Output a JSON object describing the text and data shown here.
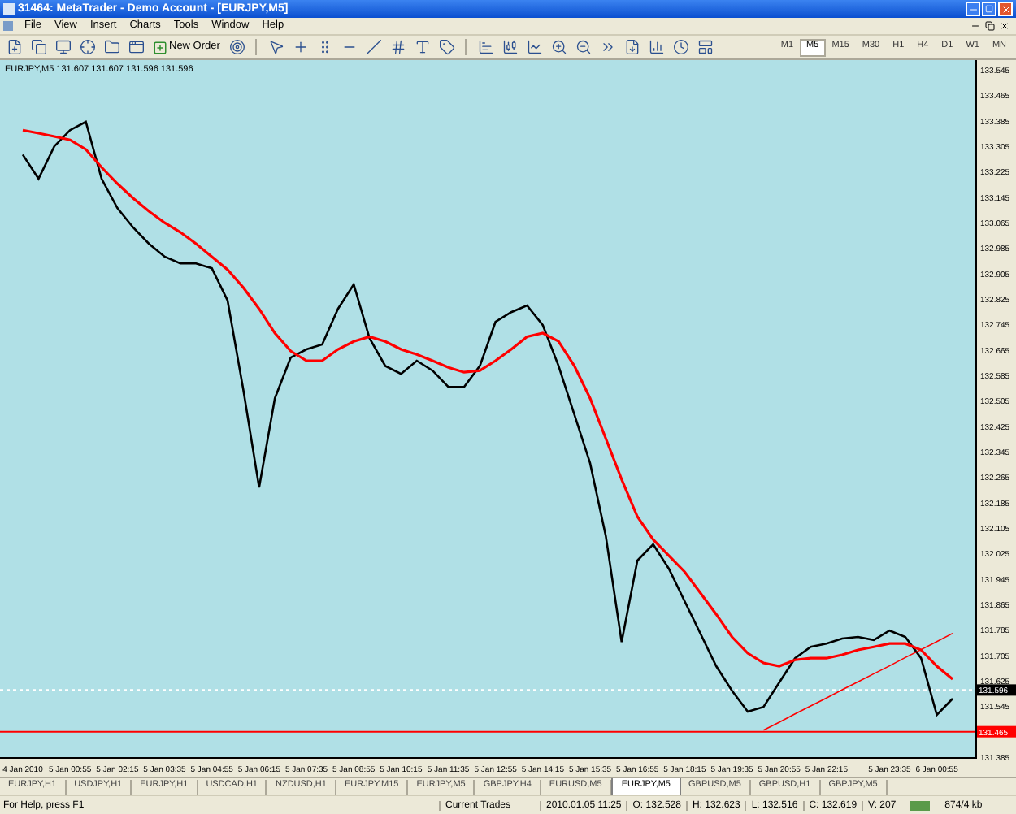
{
  "window": {
    "title": "31464: MetaTrader - Demo Account - [EURJPY,M5]"
  },
  "menu": [
    "File",
    "View",
    "Insert",
    "Charts",
    "Tools",
    "Window",
    "Help"
  ],
  "toolbar": {
    "new_order": "New Order"
  },
  "timeframes": [
    {
      "label": "M1",
      "selected": false
    },
    {
      "label": "M5",
      "selected": true
    },
    {
      "label": "M15",
      "selected": false
    },
    {
      "label": "M30",
      "selected": false
    },
    {
      "label": "H1",
      "selected": false
    },
    {
      "label": "H4",
      "selected": false
    },
    {
      "label": "D1",
      "selected": false
    },
    {
      "label": "W1",
      "selected": false
    },
    {
      "label": "MN",
      "selected": false
    }
  ],
  "chart": {
    "chart_data": {
      "type": "line",
      "title": "EURJPY,M5  131.607 131.607 131.596 131.596",
      "categories": [
        "4 Jan 2010",
        null,
        null,
        "5 Jan 00:55",
        null,
        null,
        "5 Jan 02:15",
        null,
        null,
        "5 Jan 03:35",
        null,
        null,
        "5 Jan 04:55",
        null,
        null,
        "5 Jan 06:15",
        null,
        null,
        "5 Jan 07:35",
        null,
        null,
        "5 Jan 08:55",
        null,
        null,
        "5 Jan 10:15",
        null,
        null,
        "5 Jan 11:35",
        null,
        null,
        "5 Jan 12:55",
        null,
        null,
        "5 Jan 14:15",
        null,
        null,
        "5 Jan 15:35",
        null,
        null,
        "5 Jan 16:55",
        null,
        null,
        "5 Jan 18:15",
        null,
        null,
        "5 Jan 19:35",
        null,
        null,
        "5 Jan 20:55",
        null,
        null,
        "5 Jan 22:15",
        null,
        null,
        null,
        "5 Jan 23:35",
        null,
        null,
        "6 Jan 00:55",
        null
      ],
      "ylim": [
        131.385,
        133.576
      ],
      "series": [
        {
          "color": "#000000",
          "values": [
            133.279,
            133.203,
            133.305,
            133.356,
            133.382,
            133.203,
            133.111,
            133.05,
            132.999,
            132.958,
            132.937,
            132.937,
            132.922,
            132.82,
            132.539,
            132.233,
            132.513,
            132.641,
            132.667,
            132.682,
            132.794,
            132.871,
            132.702,
            132.615,
            132.59,
            132.631,
            132.6,
            132.549,
            132.549,
            132.615,
            132.753,
            132.784,
            132.805,
            132.743,
            132.615,
            132.462,
            132.309,
            132.079,
            131.747,
            132.003,
            132.054,
            131.977,
            131.875,
            131.773,
            131.671,
            131.594,
            131.528,
            131.543,
            131.62,
            131.696,
            131.732,
            131.742,
            131.758,
            131.763,
            131.753,
            131.783,
            131.763,
            131.696,
            131.518,
            131.569
          ]
        },
        {
          "color": "#ff0000",
          "values": [
            133.356,
            133.346,
            133.336,
            133.325,
            133.295,
            133.239,
            133.188,
            133.142,
            133.101,
            133.065,
            133.035,
            132.999,
            132.958,
            132.917,
            132.861,
            132.794,
            132.718,
            132.662,
            132.631,
            132.631,
            132.667,
            132.692,
            132.707,
            132.692,
            132.667,
            132.651,
            132.631,
            132.61,
            132.595,
            132.6,
            132.631,
            132.667,
            132.707,
            132.718,
            132.692,
            132.615,
            132.513,
            132.386,
            132.258,
            132.141,
            132.069,
            132.018,
            131.967,
            131.901,
            131.834,
            131.763,
            131.712,
            131.681,
            131.671,
            131.691,
            131.696,
            131.696,
            131.707,
            131.722,
            131.732,
            131.742,
            131.742,
            131.722,
            131.671,
            131.63
          ]
        },
        {
          "color": "#ff0000",
          "values": [
            null,
            null,
            null,
            null,
            null,
            null,
            null,
            null,
            null,
            null,
            null,
            null,
            null,
            null,
            null,
            null,
            null,
            null,
            null,
            null,
            null,
            null,
            null,
            null,
            null,
            null,
            null,
            null,
            null,
            null,
            null,
            null,
            null,
            null,
            null,
            null,
            null,
            null,
            null,
            null,
            null,
            null,
            null,
            null,
            null,
            null,
            null,
            131.47,
            131.495,
            131.521,
            131.546,
            131.571,
            131.597,
            131.622,
            131.647,
            131.672,
            131.698,
            131.723,
            131.748,
            131.774
          ]
        }
      ],
      "yticks": [
        133.545,
        133.465,
        133.385,
        133.305,
        133.225,
        133.145,
        133.065,
        132.985,
        132.905,
        132.825,
        132.745,
        132.665,
        132.585,
        132.505,
        132.425,
        132.345,
        132.265,
        132.185,
        132.105,
        132.025,
        131.945,
        131.865,
        131.785,
        131.705,
        131.625,
        131.545,
        131.385
      ],
      "ref_lines": [
        {
          "axis": "y",
          "value": 131.596,
          "label": "131.596",
          "color": "#ffffff"
        },
        {
          "axis": "y",
          "value": 131.465,
          "label": "131.465",
          "color": "#ff0000"
        }
      ]
    }
  },
  "tabs": [
    {
      "label": "EURJPY,H1",
      "selected": false
    },
    {
      "label": "USDJPY,H1",
      "selected": false
    },
    {
      "label": "EURJPY,H1",
      "selected": false
    },
    {
      "label": "USDCAD,H1",
      "selected": false
    },
    {
      "label": "NZDUSD,H1",
      "selected": false
    },
    {
      "label": "EURJPY,M15",
      "selected": false
    },
    {
      "label": "EURJPY,M5",
      "selected": false
    },
    {
      "label": "GBPJPY,H4",
      "selected": false
    },
    {
      "label": "EURUSD,M5",
      "selected": false
    },
    {
      "label": "EURJPY,M5",
      "selected": true
    },
    {
      "label": "GBPUSD,M5",
      "selected": false
    },
    {
      "label": "GBPUSD,H1",
      "selected": false
    },
    {
      "label": "GBPJPY,M5",
      "selected": false
    }
  ],
  "status_bar": {
    "help": "For Help, press F1",
    "profile": "Current Trades",
    "time": "2010.01.05 11:25",
    "open": "O: 132.528",
    "high": "H: 132.623",
    "low": "L: 132.516",
    "close": "C: 132.619",
    "volume": "V: 207",
    "traffic": "874/4 kb"
  }
}
